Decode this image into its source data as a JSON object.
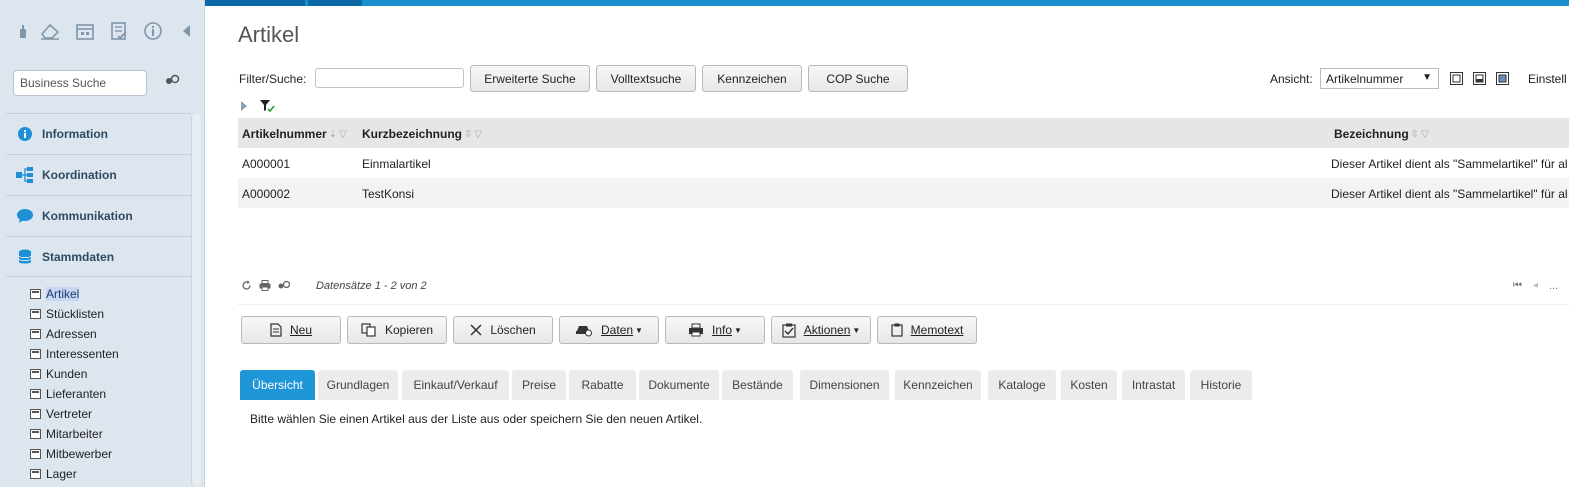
{
  "sidebar": {
    "search_placeholder": "Business Suche",
    "nav": [
      {
        "label": "Information",
        "icon": "info-circle-icon"
      },
      {
        "label": "Koordination",
        "icon": "hierarchy-icon"
      },
      {
        "label": "Kommunikation",
        "icon": "chat-bubble-icon"
      },
      {
        "label": "Stammdaten",
        "icon": "database-icon"
      }
    ],
    "sub_items": [
      "Artikel",
      "Stücklisten",
      "Adressen",
      "Interessenten",
      "Kunden",
      "Lieferanten",
      "Vertreter",
      "Mitarbeiter",
      "Mitbewerber",
      "Lager"
    ],
    "active_sub": "Artikel"
  },
  "page": {
    "title": "Artikel"
  },
  "filter": {
    "label": "Filter/Suche:",
    "value": "",
    "buttons": [
      "Erweiterte Suche",
      "Volltextsuche",
      "Kennzeichen",
      "COP Suche"
    ]
  },
  "view": {
    "label": "Ansicht:",
    "selected": "Artikelnummer",
    "settings_label": "Einstell"
  },
  "table": {
    "columns": [
      "Artikelnummer",
      "Kurzbezeichnung",
      "Bezeichnung"
    ],
    "rows": [
      [
        "A000001",
        "Einmalartikel",
        "Dieser Artikel dient als \"Sammelartikel\" für al"
      ],
      [
        "A000002",
        "TestKonsi",
        "Dieser Artikel dient als \"Sammelartikel\" für al"
      ]
    ]
  },
  "pager": {
    "info": "Datensätze 1 - 2 von 2",
    "ellipsis": "..."
  },
  "actions": [
    "Neu",
    "Kopieren",
    "Löschen",
    "Daten",
    "Info",
    "Aktionen",
    "Memotext"
  ],
  "tabs": [
    "Übersicht",
    "Grundlagen",
    "Einkauf/Verkauf",
    "Preise",
    "Rabatte",
    "Dokumente",
    "Bestände",
    "Dimensionen",
    "Kennzeichen",
    "Kataloge",
    "Kosten",
    "Intrastat",
    "Historie"
  ],
  "active_tab": "Übersicht",
  "tab_message": "Bitte wählen Sie einen Artikel aus der Liste aus oder speichern Sie den neuen Artikel.",
  "colors": {
    "accent": "#1f96d8",
    "sidebar_bg": "#dde6ee",
    "nav_text": "#2d4a63"
  }
}
